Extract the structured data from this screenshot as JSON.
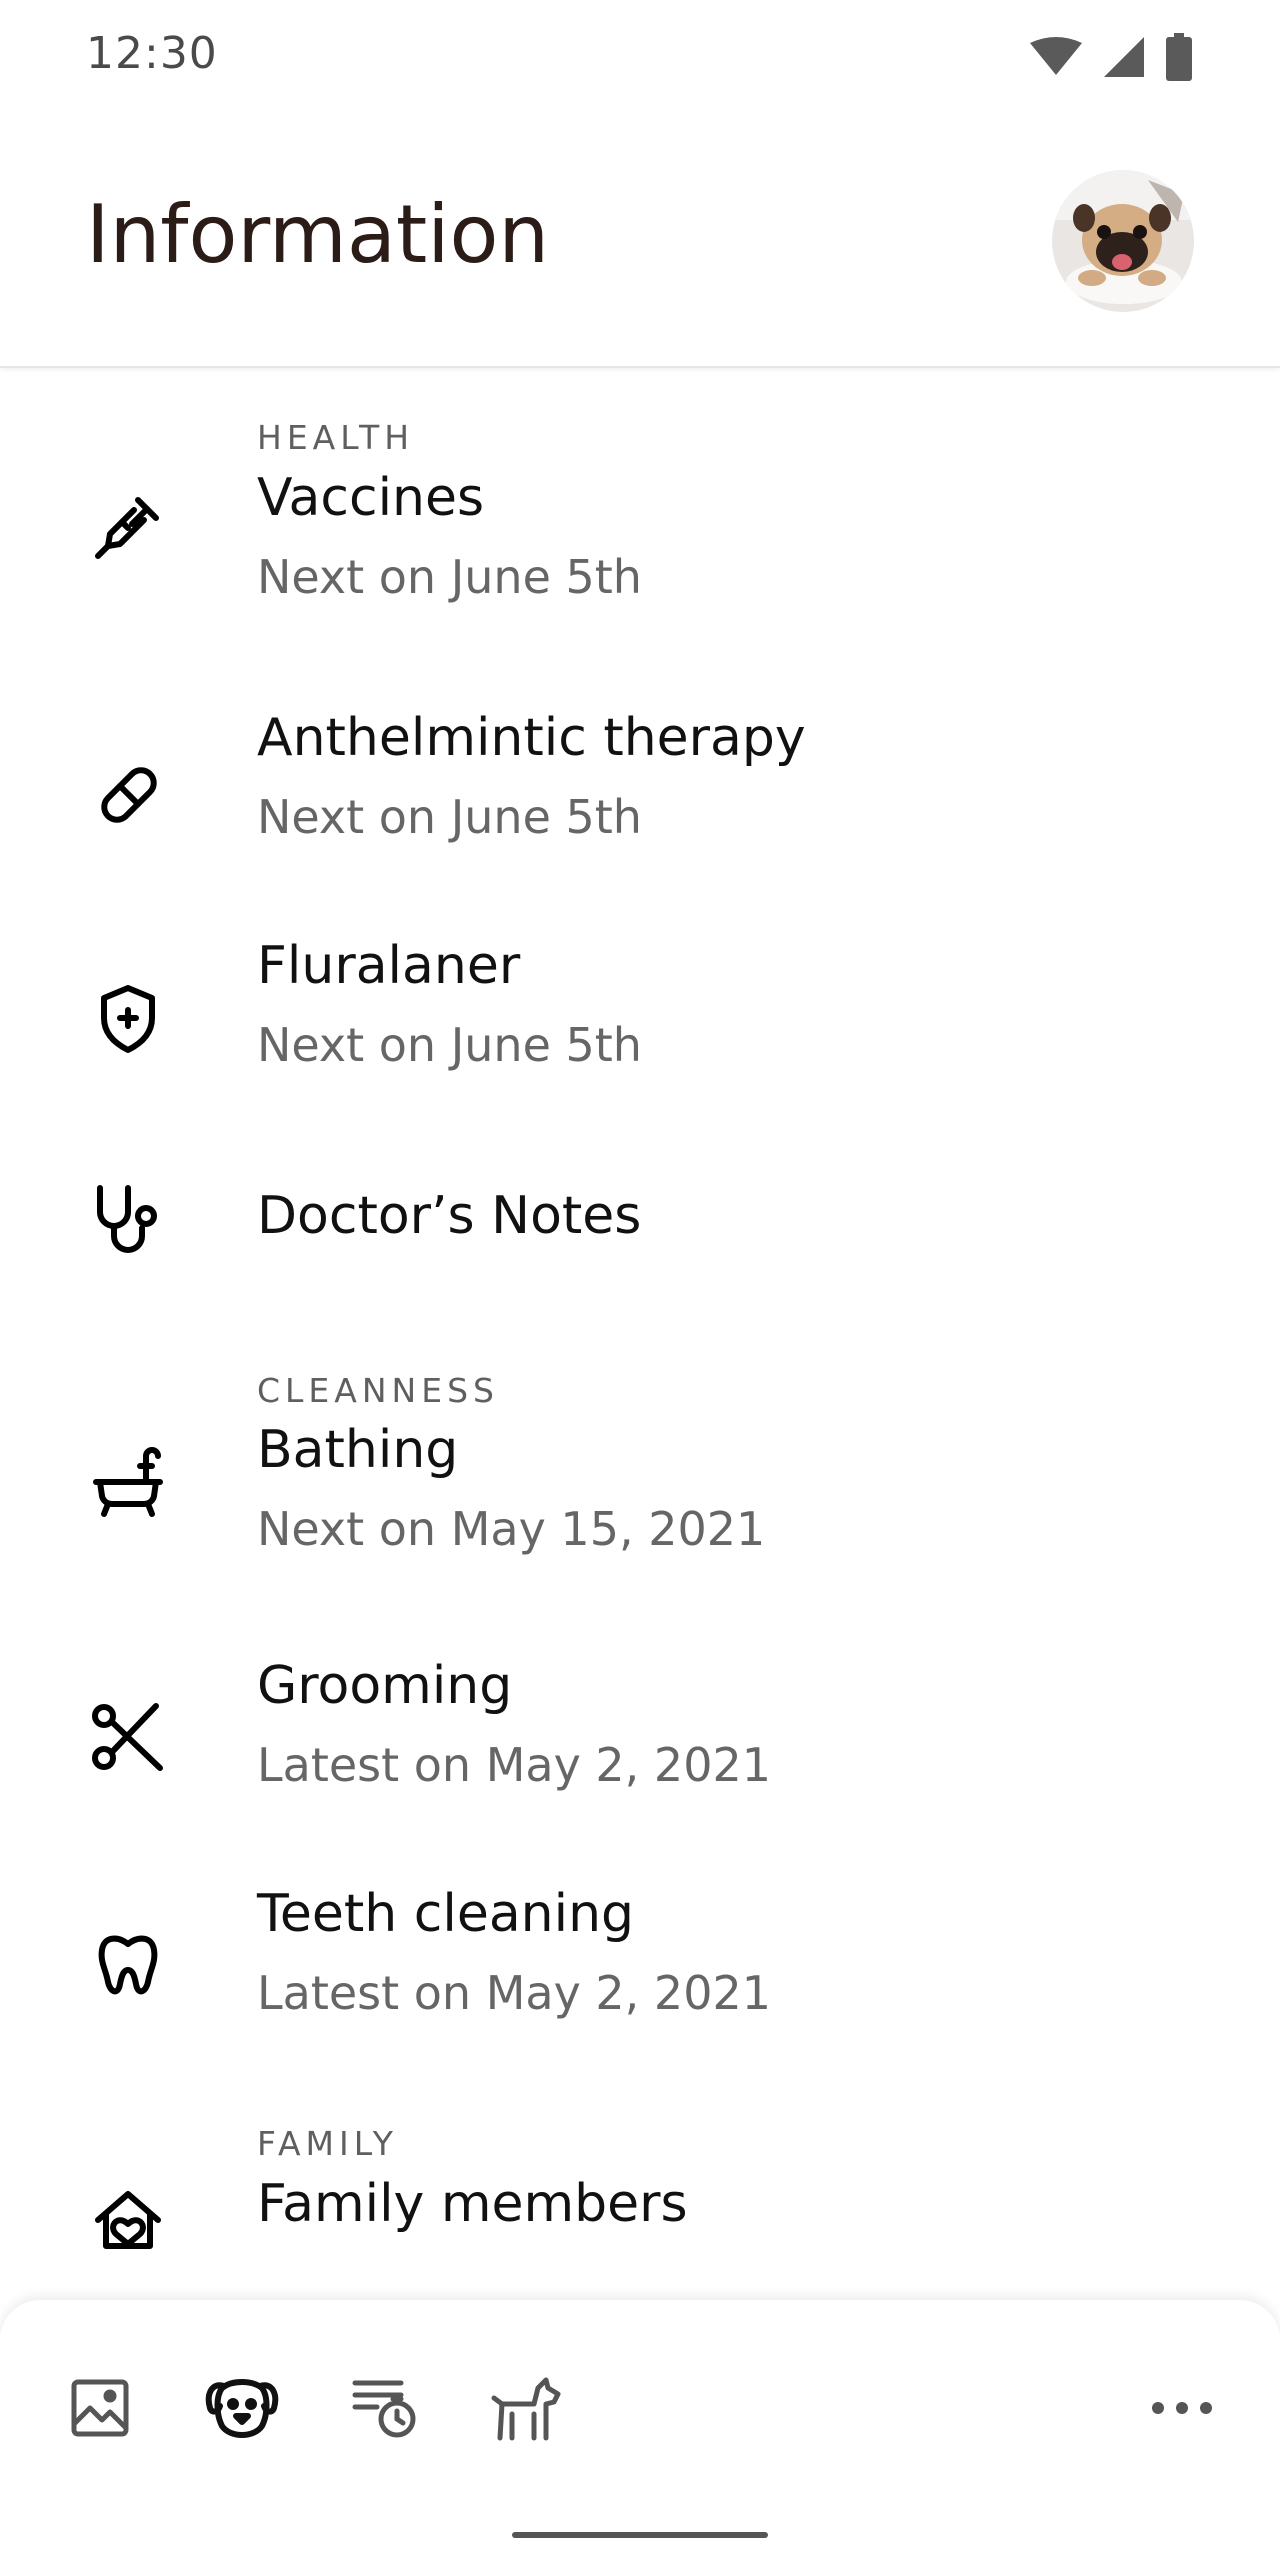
{
  "status_bar": {
    "time": "12:30",
    "icons": [
      "wifi-icon",
      "signal-icon",
      "battery-icon"
    ]
  },
  "header": {
    "title": "Information",
    "avatar_alt": "pug"
  },
  "sections": [
    {
      "label": "HEALTH",
      "items": [
        {
          "icon": "syringe-icon",
          "title": "Vaccines",
          "subtitle": "Next on June 5th"
        },
        {
          "icon": "pill-icon",
          "title": "Anthelmintic therapy",
          "subtitle": "Next on June 5th"
        },
        {
          "icon": "shield-plus-icon",
          "title": "Fluralaner",
          "subtitle": "Next on June 5th"
        },
        {
          "icon": "stethoscope-icon",
          "title": "Doctor’s Notes",
          "subtitle": ""
        }
      ]
    },
    {
      "label": "CLEANNESS",
      "items": [
        {
          "icon": "bathtub-icon",
          "title": "Bathing",
          "subtitle": "Next on May 15, 2021"
        },
        {
          "icon": "scissors-icon",
          "title": "Grooming",
          "subtitle": "Latest on May 2, 2021"
        },
        {
          "icon": "tooth-icon",
          "title": "Teeth cleaning",
          "subtitle": "Latest on May 2, 2021"
        }
      ]
    },
    {
      "label": "FAMILY",
      "items": [
        {
          "icon": "family-home-icon",
          "title": "Family members",
          "subtitle": ""
        }
      ]
    }
  ],
  "bottom_nav": {
    "items": [
      "gallery-icon",
      "dog-face-icon",
      "schedule-list-icon",
      "dog-icon"
    ],
    "active": "dog-face-icon",
    "more": "more-icon"
  },
  "colors": {
    "title": "#2b1c18",
    "subtitle": "#666666",
    "section_label": "#5f5f5f",
    "icon": "#000000"
  }
}
